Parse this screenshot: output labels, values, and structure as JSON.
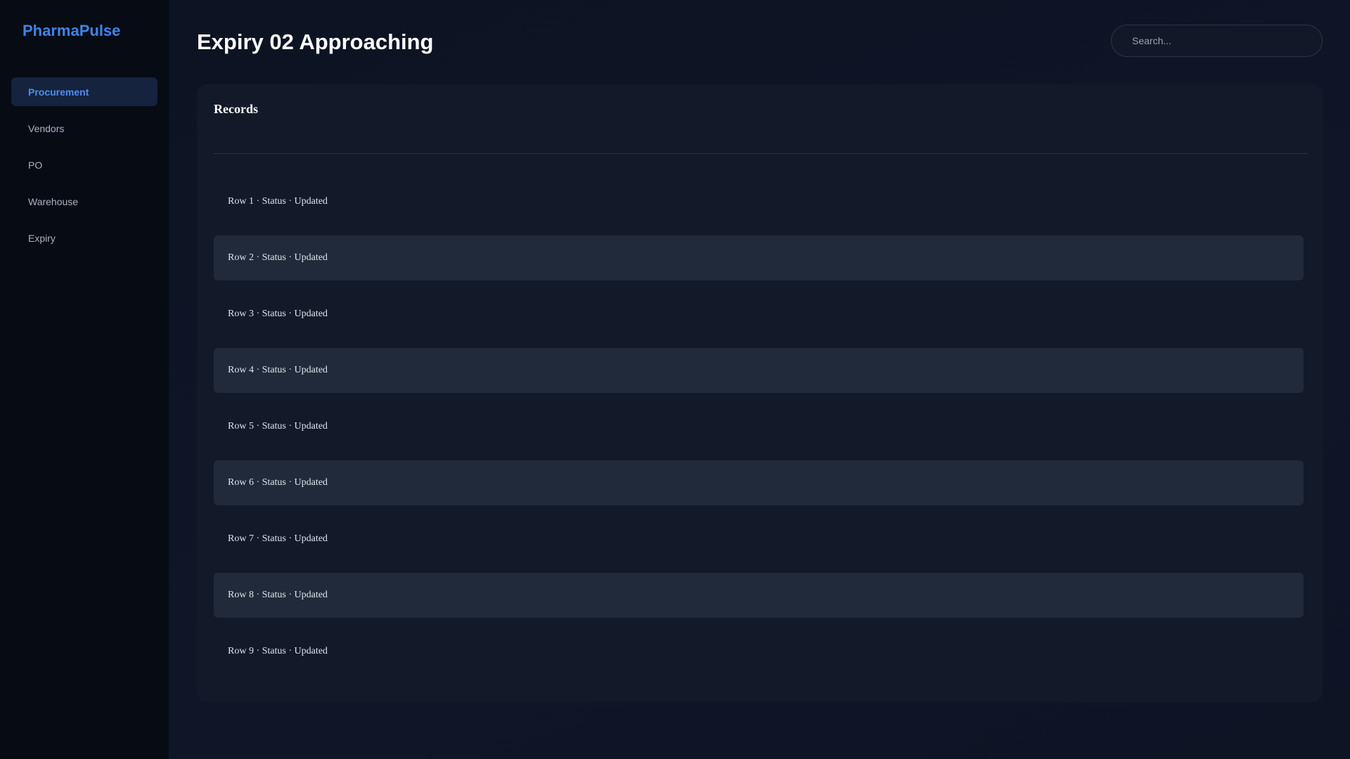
{
  "app": {
    "brand": "PharmaPulse"
  },
  "sidebar": {
    "items": [
      {
        "label": "Procurement",
        "active": true
      },
      {
        "label": "Vendors",
        "active": false
      },
      {
        "label": "PO",
        "active": false
      },
      {
        "label": "Warehouse",
        "active": false
      },
      {
        "label": "Expiry",
        "active": false
      }
    ]
  },
  "header": {
    "title": "Expiry 02 Approaching",
    "search": {
      "placeholder": "Search...",
      "value": ""
    }
  },
  "records": {
    "title": "Records",
    "rows": [
      "Row 1 · Status · Updated",
      "Row 2 · Status · Updated",
      "Row 3 · Status · Updated",
      "Row 4 · Status · Updated",
      "Row 5 · Status · Updated",
      "Row 6 · Status · Updated",
      "Row 7 · Status · Updated",
      "Row 8 · Status · Updated",
      "Row 9 · Status · Updated"
    ]
  },
  "colors": {
    "accent": "#3f84e8",
    "sidebar_bg": "#070b14",
    "main_bg": "#0d1322",
    "card_bg": "#121a2a",
    "row_alt_bg": "#202a3a"
  }
}
